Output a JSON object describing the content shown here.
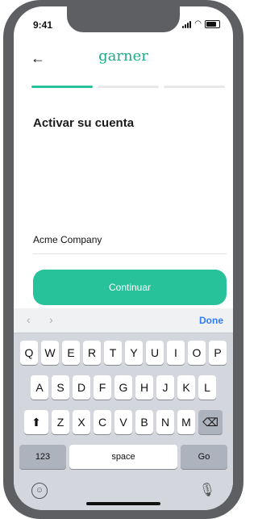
{
  "status_bar": {
    "time": "9:41"
  },
  "header": {
    "back_icon": "arrow-left-icon",
    "brand": "garner"
  },
  "progress": {
    "steps": 3,
    "current": 1
  },
  "form": {
    "title": "Activar su cuenta",
    "company_value": "Acme Company",
    "continue_label": "Continuar"
  },
  "keyboard": {
    "done_label": "Done",
    "row1": [
      "Q",
      "W",
      "E",
      "R",
      "T",
      "Y",
      "U",
      "I",
      "O",
      "P"
    ],
    "row2": [
      "A",
      "S",
      "D",
      "F",
      "G",
      "H",
      "J",
      "K",
      "L"
    ],
    "row3": [
      "Z",
      "X",
      "C",
      "V",
      "B",
      "N",
      "M"
    ],
    "numbers_label": "123",
    "space_label": "space",
    "go_label": "Go"
  }
}
